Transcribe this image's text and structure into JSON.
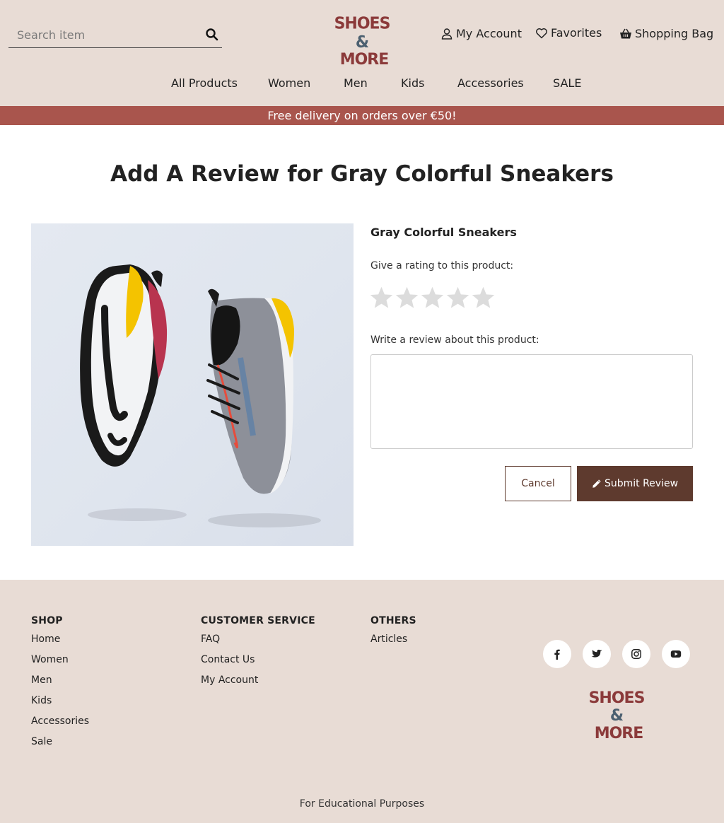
{
  "header": {
    "search_placeholder": "Search item",
    "logo": {
      "line1": "SHOES",
      "amp": "&",
      "line2": "MORE"
    },
    "links": {
      "account": "My Account",
      "favorites": "Favorites",
      "bag": "Shopping Bag"
    }
  },
  "nav": [
    "All Products",
    "Women",
    "Men",
    "Kids",
    "Accessories",
    "SALE"
  ],
  "promo": "Free delivery on orders over €50!",
  "main": {
    "title": "Add A Review for Gray Colorful Sneakers",
    "product_name": "Gray Colorful Sneakers",
    "rating_label": "Give a rating to this product:",
    "rating": {
      "value": 0,
      "max": 5
    },
    "review_label": "Write a review about this product:",
    "review_value": "",
    "cancel_label": "Cancel",
    "submit_label": "Submit Review"
  },
  "footer": {
    "shop": {
      "heading": "SHOP",
      "items": [
        "Home",
        "Women",
        "Men",
        "Kids",
        "Accessories",
        "Sale"
      ]
    },
    "service": {
      "heading": "CUSTOMER SERVICE",
      "items": [
        "FAQ",
        "Contact Us",
        "My Account"
      ]
    },
    "others": {
      "heading": "OTHERS",
      "items": [
        "Articles"
      ]
    },
    "social_icons": [
      "facebook-icon",
      "twitter-icon",
      "instagram-icon",
      "youtube-icon"
    ],
    "note": "For Educational Purposes"
  },
  "colors": {
    "header_bg": "#e8dcd5",
    "promo_bg": "#a9554d",
    "brand_brown": "#5e3a2e",
    "logo_red": "#8b3a3a",
    "logo_slate": "#4c6070",
    "star_inactive": "#dcdcdc"
  }
}
